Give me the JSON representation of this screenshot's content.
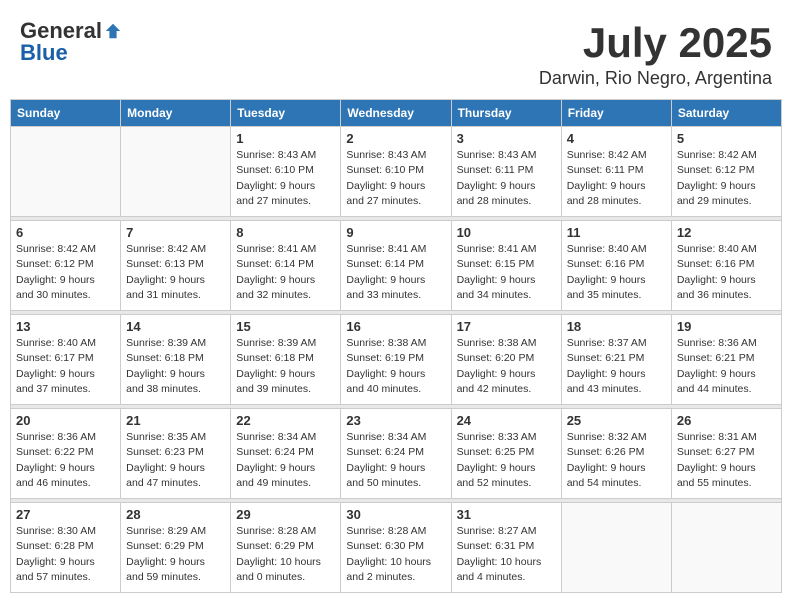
{
  "header": {
    "logo_general": "General",
    "logo_blue": "Blue",
    "month_year": "July 2025",
    "location": "Darwin, Rio Negro, Argentina"
  },
  "days_of_week": [
    "Sunday",
    "Monday",
    "Tuesday",
    "Wednesday",
    "Thursday",
    "Friday",
    "Saturday"
  ],
  "weeks": [
    [
      {
        "day": "",
        "info": ""
      },
      {
        "day": "",
        "info": ""
      },
      {
        "day": "1",
        "info": "Sunrise: 8:43 AM\nSunset: 6:10 PM\nDaylight: 9 hours\nand 27 minutes."
      },
      {
        "day": "2",
        "info": "Sunrise: 8:43 AM\nSunset: 6:10 PM\nDaylight: 9 hours\nand 27 minutes."
      },
      {
        "day": "3",
        "info": "Sunrise: 8:43 AM\nSunset: 6:11 PM\nDaylight: 9 hours\nand 28 minutes."
      },
      {
        "day": "4",
        "info": "Sunrise: 8:42 AM\nSunset: 6:11 PM\nDaylight: 9 hours\nand 28 minutes."
      },
      {
        "day": "5",
        "info": "Sunrise: 8:42 AM\nSunset: 6:12 PM\nDaylight: 9 hours\nand 29 minutes."
      }
    ],
    [
      {
        "day": "6",
        "info": "Sunrise: 8:42 AM\nSunset: 6:12 PM\nDaylight: 9 hours\nand 30 minutes."
      },
      {
        "day": "7",
        "info": "Sunrise: 8:42 AM\nSunset: 6:13 PM\nDaylight: 9 hours\nand 31 minutes."
      },
      {
        "day": "8",
        "info": "Sunrise: 8:41 AM\nSunset: 6:14 PM\nDaylight: 9 hours\nand 32 minutes."
      },
      {
        "day": "9",
        "info": "Sunrise: 8:41 AM\nSunset: 6:14 PM\nDaylight: 9 hours\nand 33 minutes."
      },
      {
        "day": "10",
        "info": "Sunrise: 8:41 AM\nSunset: 6:15 PM\nDaylight: 9 hours\nand 34 minutes."
      },
      {
        "day": "11",
        "info": "Sunrise: 8:40 AM\nSunset: 6:16 PM\nDaylight: 9 hours\nand 35 minutes."
      },
      {
        "day": "12",
        "info": "Sunrise: 8:40 AM\nSunset: 6:16 PM\nDaylight: 9 hours\nand 36 minutes."
      }
    ],
    [
      {
        "day": "13",
        "info": "Sunrise: 8:40 AM\nSunset: 6:17 PM\nDaylight: 9 hours\nand 37 minutes."
      },
      {
        "day": "14",
        "info": "Sunrise: 8:39 AM\nSunset: 6:18 PM\nDaylight: 9 hours\nand 38 minutes."
      },
      {
        "day": "15",
        "info": "Sunrise: 8:39 AM\nSunset: 6:18 PM\nDaylight: 9 hours\nand 39 minutes."
      },
      {
        "day": "16",
        "info": "Sunrise: 8:38 AM\nSunset: 6:19 PM\nDaylight: 9 hours\nand 40 minutes."
      },
      {
        "day": "17",
        "info": "Sunrise: 8:38 AM\nSunset: 6:20 PM\nDaylight: 9 hours\nand 42 minutes."
      },
      {
        "day": "18",
        "info": "Sunrise: 8:37 AM\nSunset: 6:21 PM\nDaylight: 9 hours\nand 43 minutes."
      },
      {
        "day": "19",
        "info": "Sunrise: 8:36 AM\nSunset: 6:21 PM\nDaylight: 9 hours\nand 44 minutes."
      }
    ],
    [
      {
        "day": "20",
        "info": "Sunrise: 8:36 AM\nSunset: 6:22 PM\nDaylight: 9 hours\nand 46 minutes."
      },
      {
        "day": "21",
        "info": "Sunrise: 8:35 AM\nSunset: 6:23 PM\nDaylight: 9 hours\nand 47 minutes."
      },
      {
        "day": "22",
        "info": "Sunrise: 8:34 AM\nSunset: 6:24 PM\nDaylight: 9 hours\nand 49 minutes."
      },
      {
        "day": "23",
        "info": "Sunrise: 8:34 AM\nSunset: 6:24 PM\nDaylight: 9 hours\nand 50 minutes."
      },
      {
        "day": "24",
        "info": "Sunrise: 8:33 AM\nSunset: 6:25 PM\nDaylight: 9 hours\nand 52 minutes."
      },
      {
        "day": "25",
        "info": "Sunrise: 8:32 AM\nSunset: 6:26 PM\nDaylight: 9 hours\nand 54 minutes."
      },
      {
        "day": "26",
        "info": "Sunrise: 8:31 AM\nSunset: 6:27 PM\nDaylight: 9 hours\nand 55 minutes."
      }
    ],
    [
      {
        "day": "27",
        "info": "Sunrise: 8:30 AM\nSunset: 6:28 PM\nDaylight: 9 hours\nand 57 minutes."
      },
      {
        "day": "28",
        "info": "Sunrise: 8:29 AM\nSunset: 6:29 PM\nDaylight: 9 hours\nand 59 minutes."
      },
      {
        "day": "29",
        "info": "Sunrise: 8:28 AM\nSunset: 6:29 PM\nDaylight: 10 hours\nand 0 minutes."
      },
      {
        "day": "30",
        "info": "Sunrise: 8:28 AM\nSunset: 6:30 PM\nDaylight: 10 hours\nand 2 minutes."
      },
      {
        "day": "31",
        "info": "Sunrise: 8:27 AM\nSunset: 6:31 PM\nDaylight: 10 hours\nand 4 minutes."
      },
      {
        "day": "",
        "info": ""
      },
      {
        "day": "",
        "info": ""
      }
    ]
  ]
}
